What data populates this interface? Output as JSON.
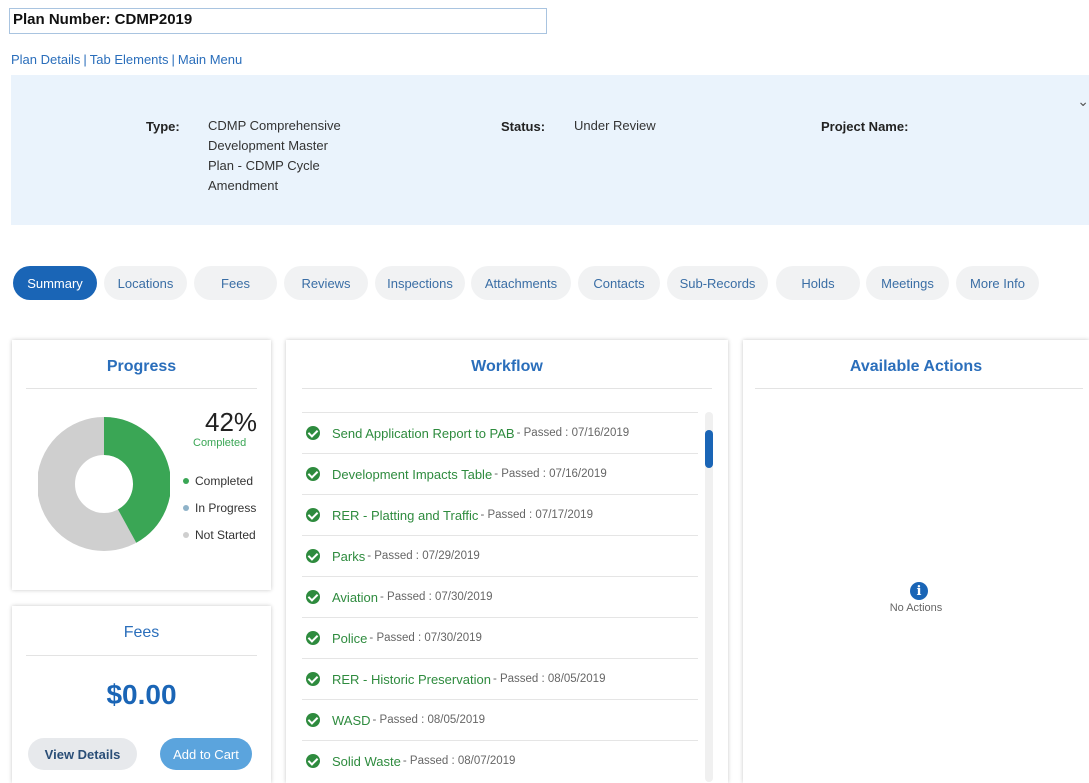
{
  "header": {
    "plan_number": "Plan Number: CDMP2019"
  },
  "nav": {
    "links": [
      "Plan Details",
      "Tab Elements",
      "Main Menu"
    ]
  },
  "info": {
    "type_label": "Type:",
    "type_value": [
      "CDMP Comprehensive",
      "Development Master",
      "Plan - CDMP Cycle",
      "Amendment"
    ],
    "status_label": "Status:",
    "status_value": "Under Review",
    "project_label": "Project Name:",
    "project_value": ""
  },
  "tabs": [
    {
      "label": "Summary",
      "active": true
    },
    {
      "label": "Locations",
      "active": false
    },
    {
      "label": "Fees",
      "active": false
    },
    {
      "label": "Reviews",
      "active": false
    },
    {
      "label": "Inspections",
      "active": false
    },
    {
      "label": "Attachments",
      "active": false
    },
    {
      "label": "Contacts",
      "active": false
    },
    {
      "label": "Sub-Records",
      "active": false
    },
    {
      "label": "Holds",
      "active": false
    },
    {
      "label": "Meetings",
      "active": false
    },
    {
      "label": "More Info",
      "active": false
    }
  ],
  "progress": {
    "title": "Progress",
    "percent_text": "42%",
    "completed_caption": "Completed",
    "completed_fraction": 0.42,
    "legend": [
      {
        "label": "Completed",
        "color": "#3aa655"
      },
      {
        "label": "In Progress",
        "color": "#8fb3c9"
      },
      {
        "label": "Not Started",
        "color": "#cfcfcf"
      }
    ]
  },
  "fees": {
    "title": "Fees",
    "amount": "$0.00",
    "view_details": "View Details",
    "add_to_cart": "Add to Cart"
  },
  "workflow": {
    "title": "Workflow",
    "items": [
      {
        "name": "Send Application Report to PAB",
        "status": "- Passed : 07/16/2019"
      },
      {
        "name": "Development Impacts Table",
        "status": "- Passed : 07/16/2019"
      },
      {
        "name": "RER - Platting and Traffic",
        "status": "- Passed : 07/17/2019"
      },
      {
        "name": "Parks",
        "status": "- Passed : 07/29/2019"
      },
      {
        "name": "Aviation",
        "status": "- Passed : 07/30/2019"
      },
      {
        "name": "Police",
        "status": "- Passed : 07/30/2019"
      },
      {
        "name": "RER - Historic Preservation",
        "status": "- Passed : 08/05/2019"
      },
      {
        "name": "WASD",
        "status": "- Passed : 08/05/2019"
      },
      {
        "name": "Solid Waste",
        "status": "- Passed : 08/07/2019"
      }
    ]
  },
  "actions": {
    "title": "Available Actions",
    "empty_text": "No Actions",
    "info_glyph": "i"
  },
  "colors": {
    "accent": "#1a65b6",
    "success": "#2e8b3e",
    "panel": "#eaf3fc"
  }
}
